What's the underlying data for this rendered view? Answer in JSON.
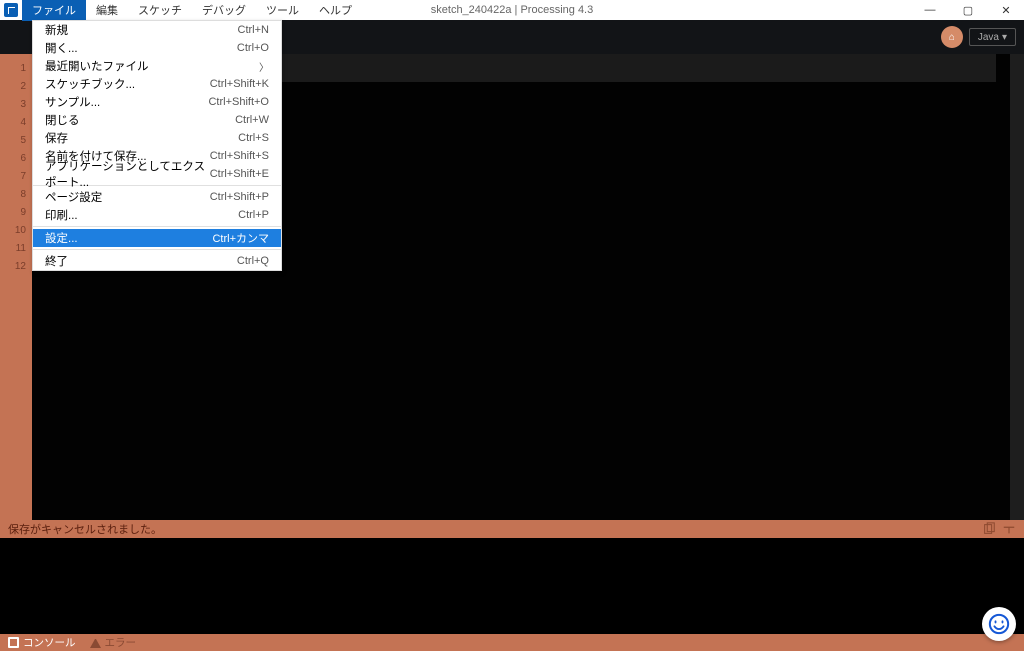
{
  "window": {
    "title": "sketch_240422a | Processing 4.3"
  },
  "menubar": [
    "ファイル",
    "編集",
    "スケッチ",
    "デバッグ",
    "ツール",
    "ヘルプ"
  ],
  "active_menu_index": 0,
  "file_menu": [
    {
      "type": "item",
      "label": "新規",
      "shortcut": "Ctrl+N"
    },
    {
      "type": "item",
      "label": "開く...",
      "shortcut": "Ctrl+O"
    },
    {
      "type": "sub",
      "label": "最近開いたファイル",
      "shortcut": ""
    },
    {
      "type": "item",
      "label": "スケッチブック...",
      "shortcut": "Ctrl+Shift+K"
    },
    {
      "type": "item",
      "label": "サンプル...",
      "shortcut": "Ctrl+Shift+O"
    },
    {
      "type": "item",
      "label": "閉じる",
      "shortcut": "Ctrl+W"
    },
    {
      "type": "item",
      "label": "保存",
      "shortcut": "Ctrl+S"
    },
    {
      "type": "item",
      "label": "名前を付けて保存...",
      "shortcut": "Ctrl+Shift+S"
    },
    {
      "type": "item",
      "label": "アプリケーションとしてエクスポート...",
      "shortcut": "Ctrl+Shift+E"
    },
    {
      "type": "sep"
    },
    {
      "type": "item",
      "label": "ページ設定",
      "shortcut": "Ctrl+Shift+P"
    },
    {
      "type": "item",
      "label": "印刷...",
      "shortcut": "Ctrl+P"
    },
    {
      "type": "sep"
    },
    {
      "type": "item",
      "label": "設定...",
      "shortcut": "Ctrl+カンマ",
      "highlight": true
    },
    {
      "type": "sep"
    },
    {
      "type": "item",
      "label": "終了",
      "shortcut": "Ctrl+Q"
    }
  ],
  "toolbar": {
    "debug_glyph": "⌂",
    "mode_label": "Java",
    "mode_caret": "▾"
  },
  "gutter_lines": [
    "1",
    "2",
    "3",
    "4",
    "5",
    "6",
    "7",
    "8",
    "9",
    "10",
    "11",
    "12"
  ],
  "status_message": "保存がキャンセルされました。",
  "footer": {
    "console_tab": "コンソール",
    "errors_tab": "エラー"
  }
}
